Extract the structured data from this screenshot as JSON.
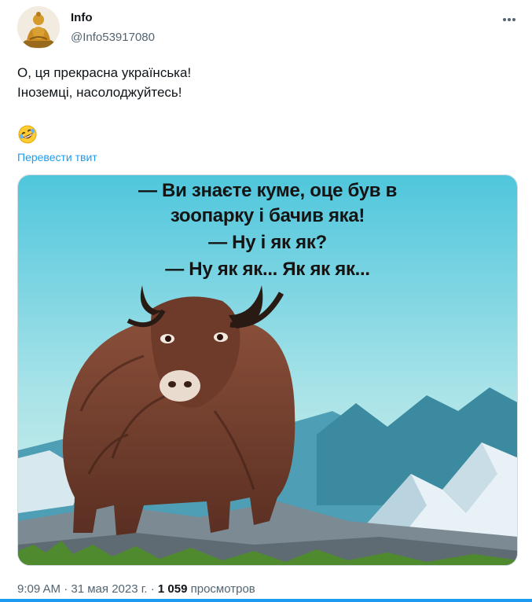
{
  "author": {
    "display_name": "Info",
    "handle": "@Info53917080"
  },
  "tweet": {
    "lines": [
      "О, ця прекрасна українська!",
      "Іноземці, насолоджуйтесь!"
    ],
    "emoji": "rolling-on-the-floor-laughing",
    "translate_label": "Перевести твит"
  },
  "media": {
    "meme_lines": [
      "— Ви знаєте куме, оце був в",
      "зоопарку і бачив яка!",
      "— Ну і як як?",
      "— Ну як як... Як як як..."
    ]
  },
  "meta": {
    "time": "9:09 AM",
    "date": "31 мая 2023 г.",
    "separator": "·",
    "views_count": "1 059",
    "views_label": "просмотров"
  },
  "colors": {
    "accent": "#1d9bf0",
    "text": "#0f1419",
    "secondary": "#536471"
  },
  "icons": {
    "more": "more-horizontal-icon",
    "avatar": "buddha-statue-avatar"
  }
}
